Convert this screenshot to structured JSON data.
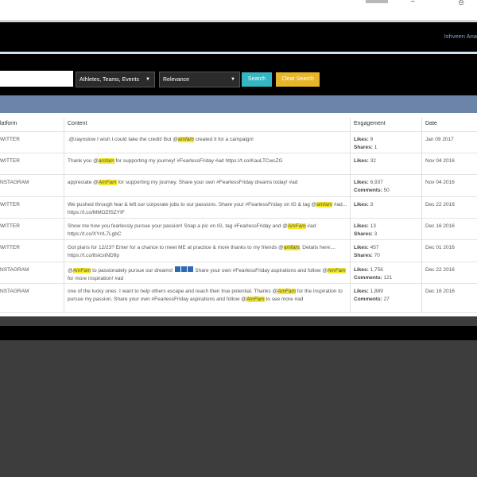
{
  "window": {
    "chrome_min": "–",
    "chrome_restore": "⎙"
  },
  "header": {
    "user_name": "Ishveen Ana"
  },
  "search": {
    "input_value": "",
    "category": "Athletes, Teams, Events",
    "sort": "Relevance",
    "search_label": "Search",
    "clear_label": "Clear Search",
    "caret": "▼"
  },
  "table": {
    "headers": {
      "platform": "latform",
      "content": "Content",
      "engagement": "Engagement",
      "date": "Date"
    },
    "labels": {
      "likes": "Likes:",
      "shares": "Shares:",
      "comments": "Comments:"
    },
    "rows": [
      {
        "platform": "WITTER",
        "content_parts": [
          ".@zaynslow I wish I could take the credit! But @",
          "amfam",
          " created it for a campaign!"
        ],
        "likes": "9",
        "second_label": "shares",
        "second_value": "1",
        "date": "Jan 09 2017"
      },
      {
        "platform": "WITTER",
        "content_parts": [
          "Thank you @",
          "amfam",
          " for supporting my journey! #FearlessFriday #ad https://t.co/KauLTCwcZG"
        ],
        "likes": "32",
        "second_label": "",
        "second_value": "",
        "date": "Nov 04 2016"
      },
      {
        "platform": "NSTAGRAM",
        "content_parts": [
          "appreciate @",
          "AmFam",
          " for supporting my journey. Share your own #FearlessFriday dreams today! #ad"
        ],
        "likes": "6,937",
        "second_label": "comments",
        "second_value": "50",
        "date": "Nov 04 2016"
      },
      {
        "platform": "WITTER",
        "content_parts": [
          "We pushed through fear & left our corporate jobs to our passions. Share your #FearlessFriday on IG & tag @",
          "amfam",
          " #ad... https://t.co/MMOZfSZYIF"
        ],
        "likes": "3",
        "second_label": "",
        "second_value": "",
        "date": "Dec 22 2016"
      },
      {
        "platform": "WITTER",
        "content_parts": [
          "Show me how you fearlessly pursue your passion! Snap a pic on IG, tag #FearlessFriday and @",
          "AmFam",
          " #ad https://t.co/XYrrL7LgbC"
        ],
        "likes": "13",
        "second_label": "shares",
        "second_value": "3",
        "date": "Dec 16 2016"
      },
      {
        "platform": "WITTER",
        "content_parts": [
          "Got plans for 12/23? Enter for a chance to meet ME at practice & more thanks to my friends @",
          "amfam",
          ". Details here:... https://t.co/8slcstND9p"
        ],
        "likes": "457",
        "second_label": "shares",
        "second_value": "70",
        "date": "Dec 01 2016"
      },
      {
        "platform": "NSTAGRAM",
        "content_parts": [
          "@",
          "AmFam",
          " to passionately pursue our dreams! ",
          "EMOJI",
          " Share your own #FearlessFriday aspirations and follow @",
          "AmFam",
          " for more inspiration! #ad"
        ],
        "likes": "1,756",
        "second_label": "comments",
        "second_value": "121",
        "date": "Dec 22 2016"
      },
      {
        "platform": "NSTAGRAM",
        "content_parts": [
          "one of the lucky ones. I want to help others escape and reach their true potential. Thanks @",
          "AmFam",
          " for the inspiration to pursue my passion. Share your own #FearlessFriday aspirations and follow @",
          "AmFam",
          " to see more #ad"
        ],
        "likes": "1,889",
        "second_label": "comments",
        "second_value": "27",
        "date": "Dec 16 2016"
      }
    ]
  },
  "colors": {
    "header": "#000000",
    "band": "#6b84a8",
    "search_button": "#35b6c3",
    "clear_button": "#e7b52a",
    "highlight": "#f4e82b"
  }
}
